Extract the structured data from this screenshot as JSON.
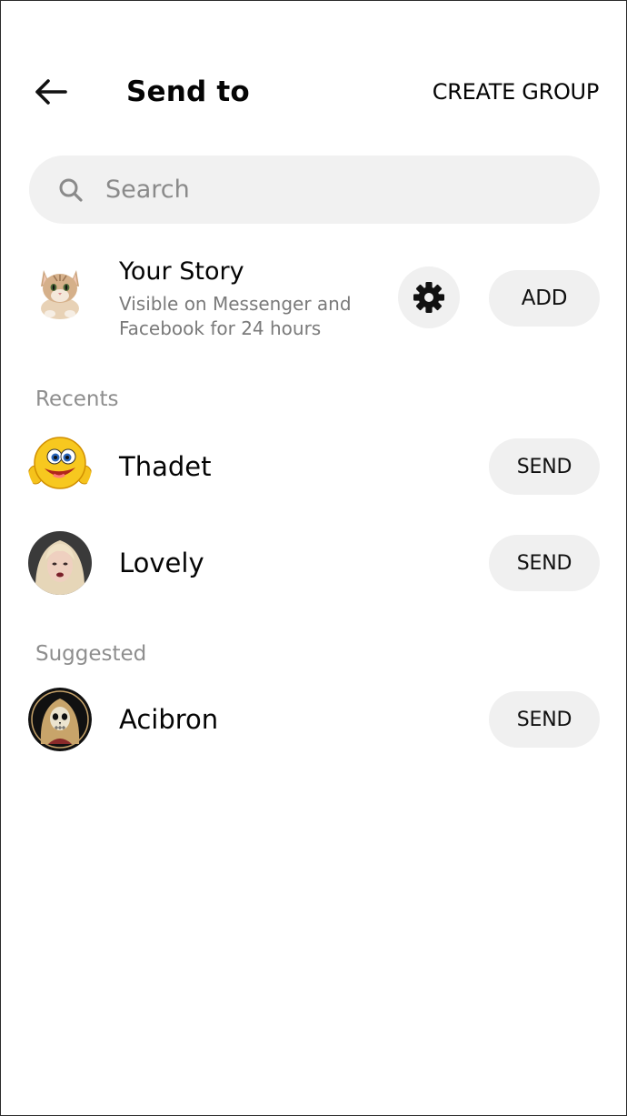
{
  "header": {
    "title": "Send to",
    "create_group_label": "CREATE GROUP",
    "back_icon": "arrow-left-icon"
  },
  "search": {
    "placeholder": "Search",
    "icon": "search-icon"
  },
  "story": {
    "title": "Your Story",
    "subtitle": "Visible on Messenger and Facebook for 24 hours",
    "settings_icon": "gear-icon",
    "add_label": "ADD"
  },
  "sections": {
    "recents_label": "Recents",
    "suggested_label": "Suggested"
  },
  "recents": [
    {
      "name": "Thadet",
      "button": "SEND"
    },
    {
      "name": "Lovely",
      "button": "SEND"
    }
  ],
  "suggested": [
    {
      "name": "Acibron",
      "button": "SEND"
    }
  ],
  "colors": {
    "background": "#ffffff",
    "pill": "#f0f0f0",
    "muted_text": "#8e8e8e"
  }
}
